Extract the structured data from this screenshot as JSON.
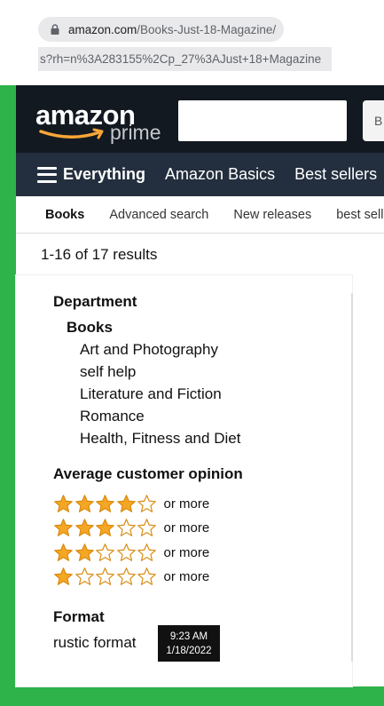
{
  "browser": {
    "url_domain": "amazon.com",
    "url_path": "/Books-Just-18-Magazine/",
    "url_query": "s?rh=n%3A283155%2Cp_27%3AJust+18+Magazine"
  },
  "header": {
    "logo_word": "amazon",
    "logo_prime": "prime",
    "search_dropdown_label": "B"
  },
  "nav": {
    "items": [
      "Everything",
      "Amazon Basics",
      "Best sellers"
    ]
  },
  "subnav": {
    "items": [
      "Books",
      "Advanced search",
      "New releases",
      "best sellers"
    ]
  },
  "results_text": "1-16 of 17 results",
  "sidebar": {
    "department_heading": "Department",
    "department_parent": "Books",
    "department_items": [
      "Art and Photography",
      "self help",
      "Literature and Fiction",
      "Romance",
      "Health, Fitness and Diet"
    ],
    "rating_heading": "Average customer opinion",
    "ratings": [
      {
        "stars": 4,
        "label": "or more"
      },
      {
        "stars": 3,
        "label": "or more"
      },
      {
        "stars": 2,
        "label": "or more"
      },
      {
        "stars": 1,
        "label": "or more"
      }
    ],
    "format_heading": "Format",
    "format_item": "rustic format"
  },
  "taskbar_clock": {
    "time": "9:23 AM",
    "date": "1/18/2022"
  },
  "colors": {
    "header_bg": "#131921",
    "nav_bg": "#232f3e",
    "star_fill": "#f5a623",
    "star_stroke": "#d8890c",
    "desktop_green": "#2db34a"
  }
}
